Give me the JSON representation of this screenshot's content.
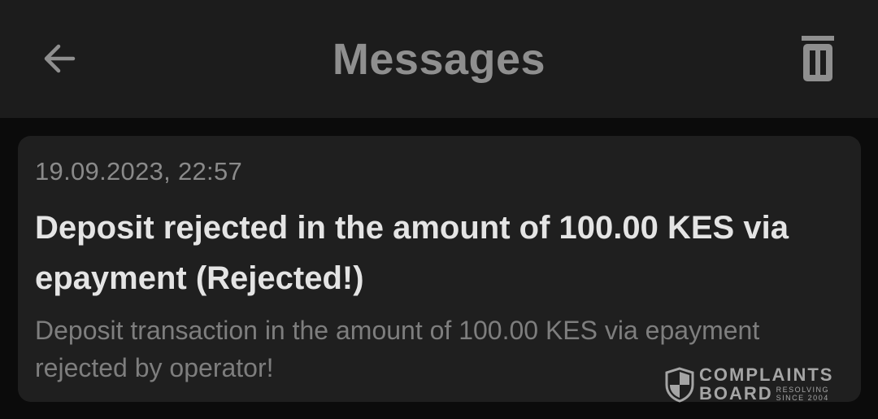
{
  "header": {
    "title": "Messages",
    "back_icon": "arrow-left-icon",
    "delete_icon": "trash-icon"
  },
  "message": {
    "date": "19.09.2023, 22:57",
    "title": "Deposit rejected in the amount of 100.00 KES via epayment (Rejected!)",
    "body": "Deposit transaction in the amount of 100.00 KES via epayment rejected by operator!"
  },
  "watermark": {
    "line1": "COMPLAINTS",
    "line2": "BOARD",
    "small1": "RESOLVING",
    "small2": "SINCE 2004"
  },
  "colors": {
    "topbar_bg": "#1c1c1c",
    "page_bg": "#0b0b0b",
    "card_bg": "#1f1f1f",
    "title_text": "#8f8f8f",
    "message_title": "#e4e4e4",
    "secondary_text": "#8a8a8a"
  }
}
